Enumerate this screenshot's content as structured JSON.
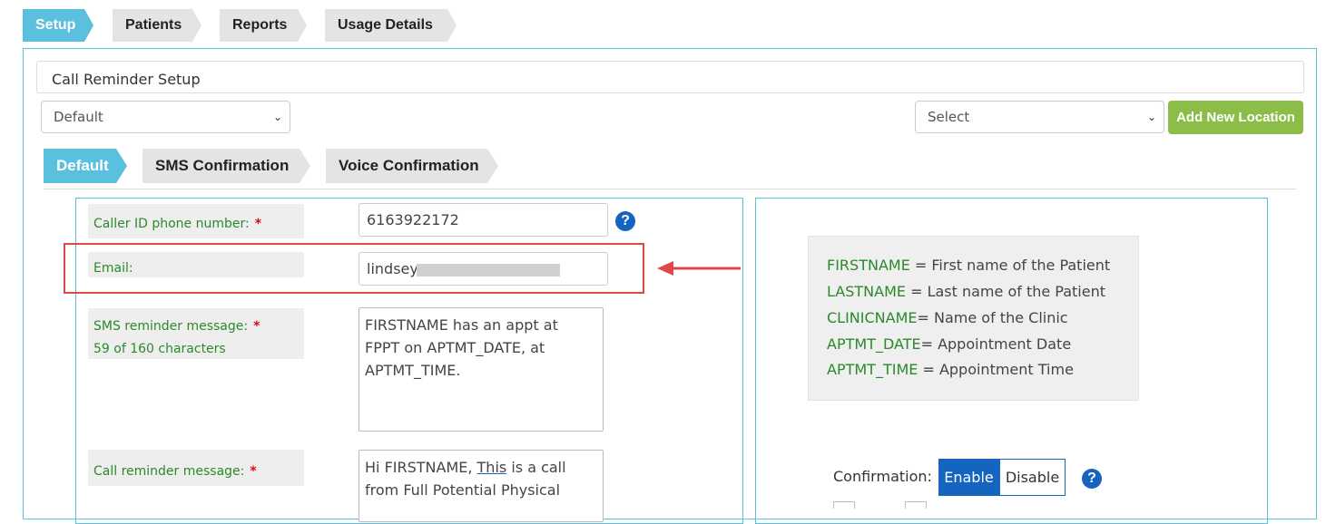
{
  "top_tabs": [
    "Setup",
    "Patients",
    "Reports",
    "Usage Details"
  ],
  "panel_title": "Call Reminder Setup",
  "profile_select": "Default",
  "location_select": "Select",
  "add_location_label": "Add New Location",
  "sub_tabs": [
    "Default",
    "SMS Confirmation",
    "Voice Confirmation"
  ],
  "form": {
    "caller_id_label": "Caller ID phone number:",
    "caller_id_value": "6163922172",
    "email_label": "Email:",
    "email_value": "lindsey",
    "sms_label": "SMS reminder message:",
    "sms_count": "59 of 160 characters",
    "sms_message_lines": [
      "FIRSTNAME has an appt at",
      "FPPT on APTMT_DATE, at",
      "APTMT_TIME."
    ],
    "call_label": "Call reminder message:",
    "call_message_line1_pre": "Hi FIRSTNAME, ",
    "call_message_line1_link": "This",
    "call_message_line1_post": " is a call",
    "call_message_line2": "from Full Potential Physical",
    "required_mark": "*"
  },
  "legend": [
    {
      "key": "FIRSTNAME",
      "sep": " = ",
      "desc": "First name of the Patient"
    },
    {
      "key": "LASTNAME",
      "sep": " = ",
      "desc": "Last name of the Patient"
    },
    {
      "key": "CLINICNAME",
      "sep": "= ",
      "desc": "Name of the Clinic"
    },
    {
      "key": "APTMT_DATE",
      "sep": "= ",
      "desc": "Appointment Date"
    },
    {
      "key": "APTMT_TIME",
      "sep": " = ",
      "desc": "Appointment Time"
    }
  ],
  "confirmation": {
    "label": "Confirmation:",
    "enable": "Enable",
    "disable": "Disable"
  },
  "help_glyph": "?",
  "chevron_glyph": "⌄",
  "colors": {
    "accent": "#5bc0de",
    "green_button": "#8bbd48",
    "label_green": "#2a8a2a",
    "primary_blue": "#1565c0",
    "highlight_red": "#e04848"
  }
}
